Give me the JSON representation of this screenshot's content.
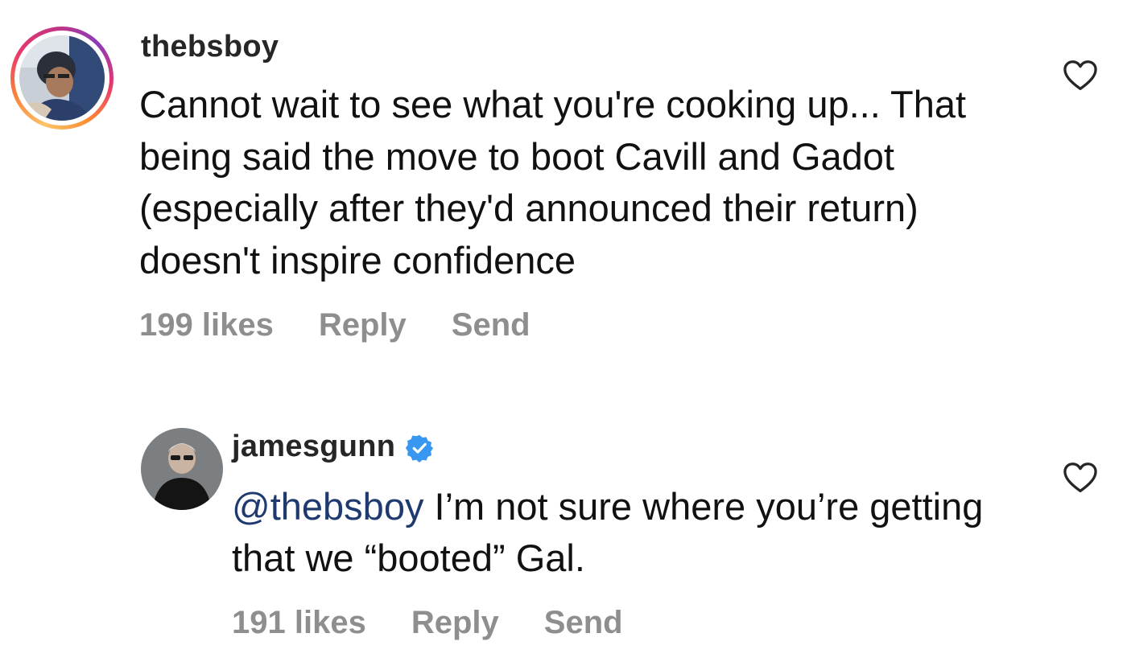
{
  "comments": [
    {
      "username": "thebsboy",
      "text": "Cannot wait to see what you're cooking up... That being said the move to boot Cavill and Gadot (especially after they'd announced their return) doesn't inspire confidence",
      "likes": "199 likes",
      "reply_label": "Reply",
      "send_label": "Send",
      "heart_icon": "heart-outline-icon",
      "has_story_ring": true
    },
    {
      "username": "jamesgunn",
      "verified": true,
      "mention": "@thebsboy",
      "text": "I’m not sure where you’re getting that we “booted” Gal.",
      "likes": "191 likes",
      "reply_label": "Reply",
      "send_label": "Send",
      "heart_icon": "heart-outline-icon"
    }
  ],
  "colors": {
    "meta_gray": "#8e8e8e",
    "mention_blue": "#1e3a6e",
    "verified_blue": "#3897f0"
  }
}
